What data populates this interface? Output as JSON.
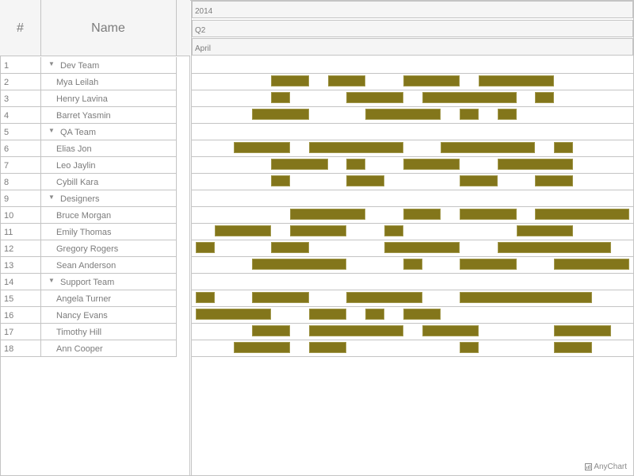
{
  "grid": {
    "columns": {
      "number": "#",
      "name": "Name"
    },
    "rows": [
      {
        "num": "1",
        "name": "Dev Team",
        "group": true
      },
      {
        "num": "2",
        "name": "Mya Leilah",
        "group": false
      },
      {
        "num": "3",
        "name": "Henry Lavina",
        "group": false
      },
      {
        "num": "4",
        "name": "Barret Yasmin",
        "group": false
      },
      {
        "num": "5",
        "name": "QA Team",
        "group": true
      },
      {
        "num": "6",
        "name": "Elias Jon",
        "group": false
      },
      {
        "num": "7",
        "name": "Leo Jaylin",
        "group": false
      },
      {
        "num": "8",
        "name": "Cybill Kara",
        "group": false
      },
      {
        "num": "9",
        "name": "Designers",
        "group": true
      },
      {
        "num": "10",
        "name": "Bruce Morgan",
        "group": false
      },
      {
        "num": "11",
        "name": "Emily Thomas",
        "group": false
      },
      {
        "num": "12",
        "name": "Gregory Rogers",
        "group": false
      },
      {
        "num": "13",
        "name": "Sean Anderson",
        "group": false
      },
      {
        "num": "14",
        "name": "Support Team",
        "group": true
      },
      {
        "num": "15",
        "name": "Angela Turner",
        "group": false
      },
      {
        "num": "16",
        "name": "Nancy Evans",
        "group": false
      },
      {
        "num": "17",
        "name": "Timothy Hill",
        "group": false
      },
      {
        "num": "18",
        "name": "Ann Cooper",
        "group": false
      }
    ],
    "expand_icon": "triangle-down-icon"
  },
  "timeline": {
    "header": {
      "year": "2014",
      "quarter": "Q2",
      "month": "April"
    },
    "bar_color": "#83761b",
    "bar_stroke": "#a0974a",
    "unit_range": [
      0,
      23.5
    ],
    "periods": [
      [],
      [
        [
          4,
          6
        ],
        [
          7,
          9
        ],
        [
          11,
          14
        ],
        [
          15,
          19
        ]
      ],
      [
        [
          4,
          5
        ],
        [
          8,
          11
        ],
        [
          12,
          17
        ],
        [
          18,
          19
        ]
      ],
      [
        [
          3,
          6
        ],
        [
          9,
          13
        ],
        [
          14,
          15
        ],
        [
          16,
          17
        ]
      ],
      [],
      [
        [
          2,
          5
        ],
        [
          6,
          11
        ],
        [
          13,
          18
        ],
        [
          19,
          20
        ]
      ],
      [
        [
          4,
          7
        ],
        [
          8,
          9
        ],
        [
          11,
          14
        ],
        [
          16,
          20
        ]
      ],
      [
        [
          4,
          5
        ],
        [
          8,
          10
        ],
        [
          14,
          16
        ],
        [
          18,
          20
        ]
      ],
      [],
      [
        [
          5,
          9
        ],
        [
          11,
          13
        ],
        [
          14,
          17
        ],
        [
          18,
          23
        ]
      ],
      [
        [
          1,
          4
        ],
        [
          5,
          8
        ],
        [
          10,
          11
        ],
        [
          17,
          20
        ]
      ],
      [
        [
          0,
          1
        ],
        [
          4,
          6
        ],
        [
          10,
          14
        ],
        [
          16,
          22
        ]
      ],
      [
        [
          3,
          8
        ],
        [
          11,
          12
        ],
        [
          14,
          17
        ],
        [
          19,
          23
        ]
      ],
      [],
      [
        [
          0,
          1
        ],
        [
          3,
          6
        ],
        [
          8,
          12
        ],
        [
          14,
          21
        ]
      ],
      [
        [
          0,
          4
        ],
        [
          6,
          8
        ],
        [
          9,
          10
        ],
        [
          11,
          13
        ]
      ],
      [
        [
          3,
          5
        ],
        [
          6,
          11
        ],
        [
          12,
          15
        ],
        [
          19,
          22
        ]
      ],
      [
        [
          2,
          5
        ],
        [
          6,
          8
        ],
        [
          14,
          15
        ],
        [
          19,
          21
        ]
      ]
    ]
  },
  "credits": {
    "label": "AnyChart",
    "icon": "anychart-logo-icon"
  }
}
